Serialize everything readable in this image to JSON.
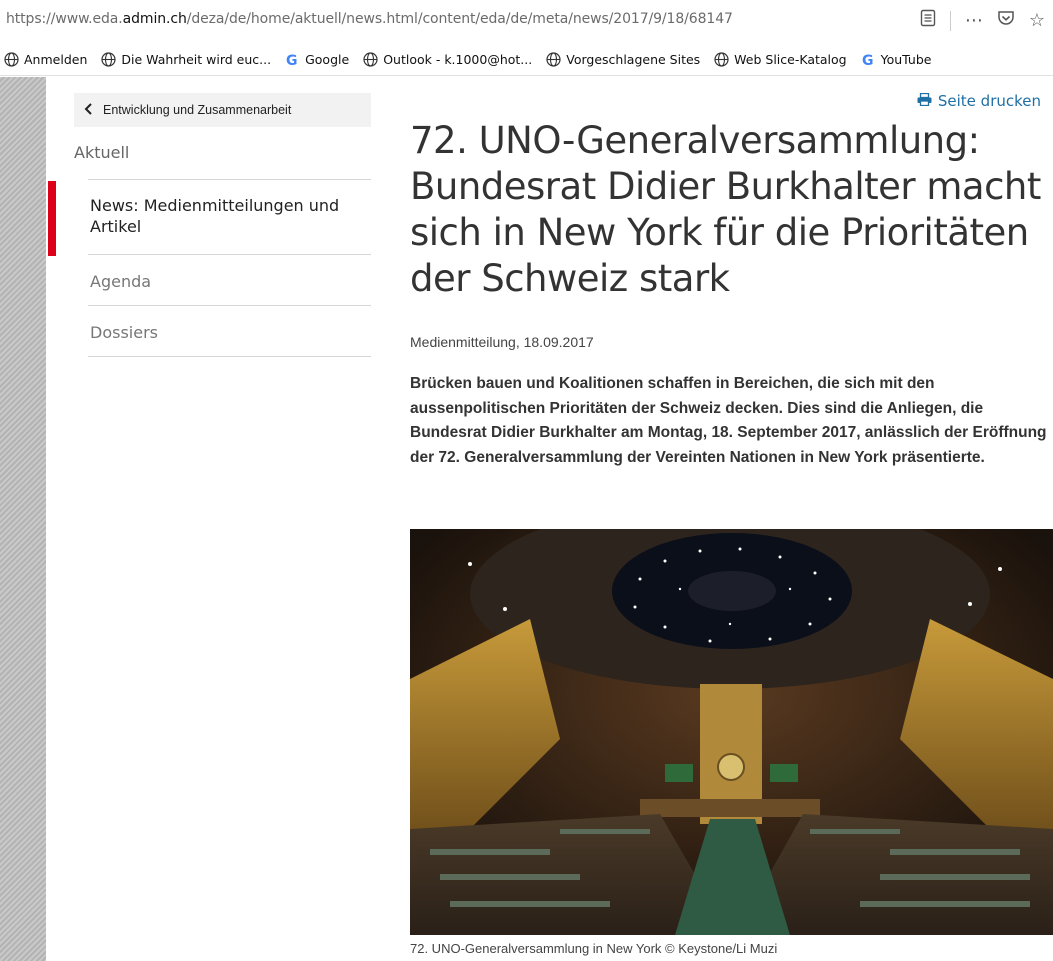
{
  "browser": {
    "url_prefix": "https://www.eda.",
    "url_domain": "admin.ch",
    "url_path": "/deza/de/home/aktuell/news.html/content/eda/de/meta/news/2017/9/18/68147",
    "bookmarks": [
      {
        "label": "Anmelden",
        "icon": "globe-icon"
      },
      {
        "label": "Die Wahrheit wird euc...",
        "icon": "globe-icon"
      },
      {
        "label": "Google",
        "icon": "google-icon"
      },
      {
        "label": "Outlook - k.1000@hot...",
        "icon": "globe-icon"
      },
      {
        "label": "Vorgeschlagene Sites",
        "icon": "globe-icon"
      },
      {
        "label": "Web Slice-Katalog",
        "icon": "globe-icon"
      },
      {
        "label": "YouTube",
        "icon": "google-icon"
      }
    ]
  },
  "sidebar": {
    "back_label": "Entwicklung und Zusammenarbeit",
    "section": "Aktuell",
    "items": [
      {
        "label": "News: Medienmitteilungen und Artikel",
        "active": true
      },
      {
        "label": "Agenda",
        "active": false
      },
      {
        "label": "Dossiers",
        "active": false
      }
    ]
  },
  "article": {
    "print_label": "Seite drucken",
    "title": "72. UNO-Generalversammlung: Bundesrat Didier Burkhalter macht sich in New York für die Prioritäten der Schweiz stark",
    "meta": "Medienmitteilung, 18.09.2017",
    "lead": "Brücken bauen und Koalitionen schaffen in Bereichen, die sich mit den aussenpolitischen Prioritäten der Schweiz decken. Dies sind die Anliegen, die Bundesrat Didier Burkhalter am Montag, 18. September 2017, anlässlich der Eröffnung der 72. Generalversammlung der Vereinten Nationen in New York präsentierte.",
    "caption": "72. UNO-Generalversammlung in New York © Keystone/Li Muzi"
  },
  "colors": {
    "accent_red": "#dc0018",
    "link_blue": "#1f6fa5"
  }
}
